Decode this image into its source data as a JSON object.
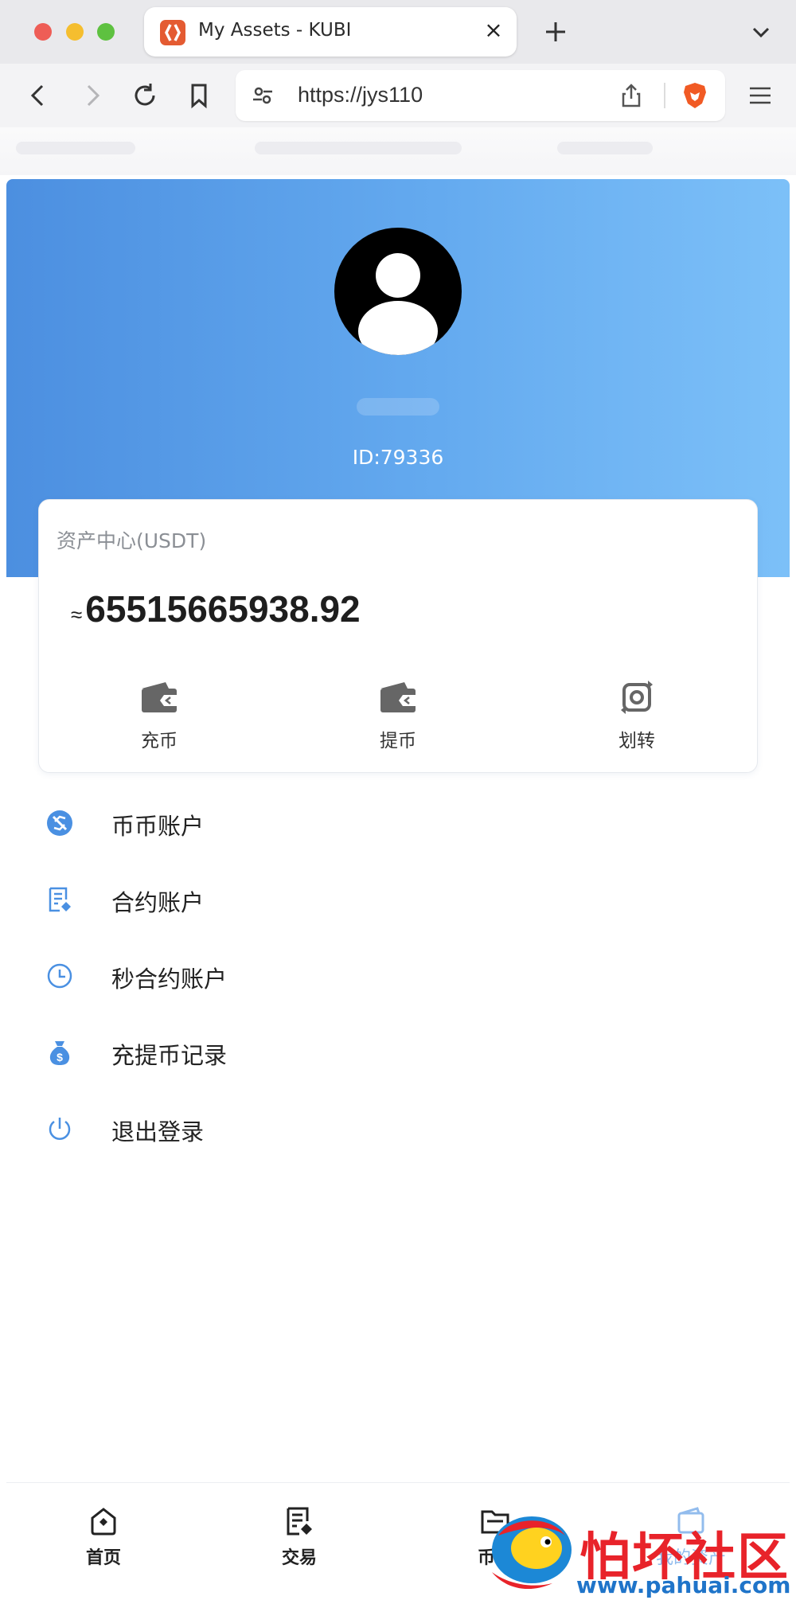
{
  "browser": {
    "tab_title": "My Assets - KUBI",
    "tab_close": "×",
    "url": "https://jys110"
  },
  "profile": {
    "id_text": "ID:79336"
  },
  "assets": {
    "title": "资产中心(USDT)",
    "approx": "≈",
    "balance": "65515665938.92",
    "actions": [
      {
        "label": "充币",
        "icon": "wallet-icon"
      },
      {
        "label": "提币",
        "icon": "wallet-icon"
      },
      {
        "label": "划转",
        "icon": "transfer-icon"
      }
    ]
  },
  "menu": [
    {
      "label": "币币账户",
      "icon": "coin-account-icon"
    },
    {
      "label": "合约账户",
      "icon": "contract-icon"
    },
    {
      "label": "秒合约账户",
      "icon": "clock-icon"
    },
    {
      "label": "充提币记录",
      "icon": "money-bag-icon"
    },
    {
      "label": "退出登录",
      "icon": "power-icon"
    }
  ],
  "bottom_nav": [
    {
      "label": "首页",
      "icon": "home-icon"
    },
    {
      "label": "交易",
      "icon": "trade-icon"
    },
    {
      "label": "币币",
      "icon": "folder-icon"
    },
    {
      "label": "我的资产",
      "icon": "wallet-icon"
    }
  ],
  "watermark": {
    "cn": "怕坏社区",
    "url": "www.pahuai.com"
  },
  "colors": {
    "hero_start": "#4c8fe0",
    "hero_end": "#7cc0f8",
    "menu_icon": "#4a90e2",
    "watermark_red": "#e8232a",
    "watermark_blue": "#1f74c9"
  }
}
